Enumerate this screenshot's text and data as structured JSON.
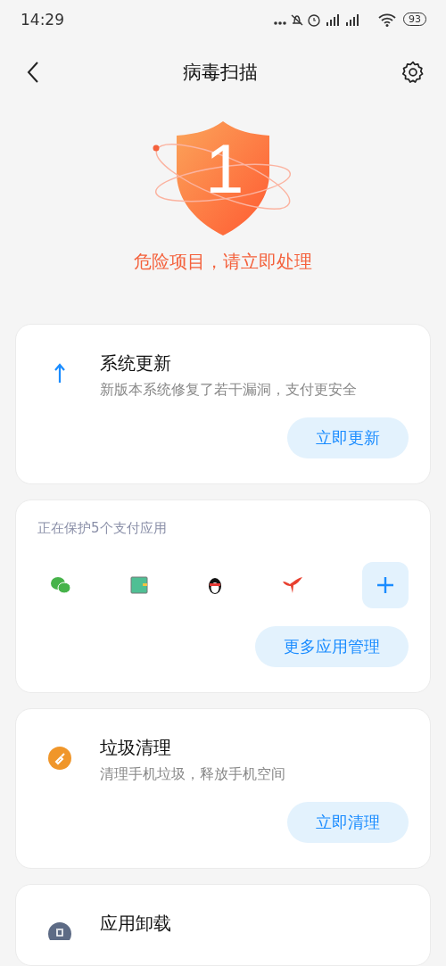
{
  "status_bar": {
    "time": "14:29",
    "battery": "93"
  },
  "header": {
    "title": "病毒扫描"
  },
  "summary": {
    "count": "1",
    "message": "危险项目，请立即处理"
  },
  "cards": [
    {
      "kind": "feature",
      "title": "系统更新",
      "subtitle": "新版本系统修复了若干漏洞，支付更安全",
      "button": "立即更新"
    },
    {
      "kind": "apps",
      "caption": "正在保护5个支付应用",
      "button": "更多应用管理"
    },
    {
      "kind": "feature",
      "title": "垃圾清理",
      "subtitle": "清理手机垃圾，释放手机空间",
      "button": "立即清理"
    },
    {
      "kind": "feature",
      "title": "应用卸载"
    }
  ]
}
